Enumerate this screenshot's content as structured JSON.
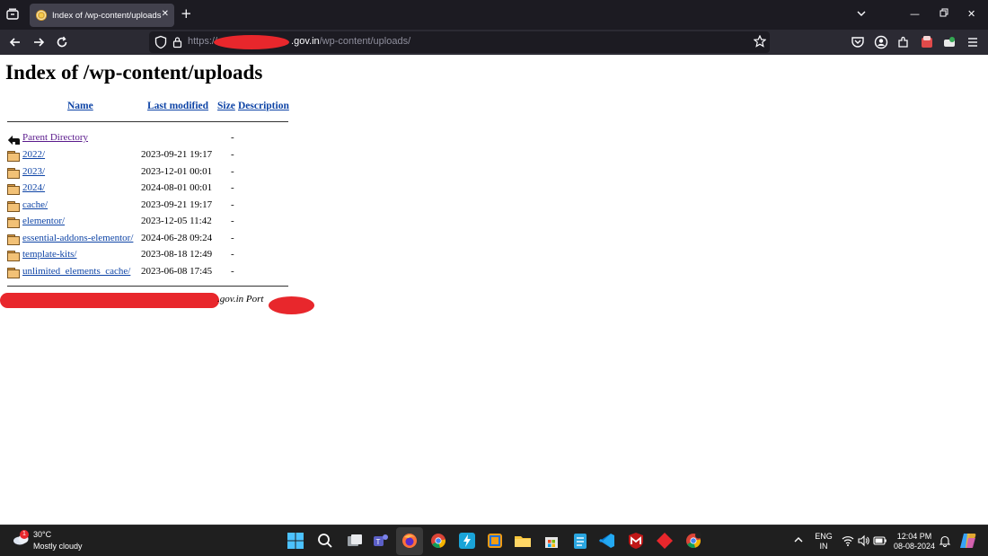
{
  "browser": {
    "tab_title": "Index of /wp-content/uploads",
    "url": {
      "scheme": "https://",
      "host_suffix": ".gov.in",
      "path": "/wp-content/uploads/"
    }
  },
  "page": {
    "heading": "Index of /wp-content/uploads",
    "columns": {
      "name": "Name",
      "last_modified": "Last modified",
      "size": "Size",
      "description": "Description"
    },
    "parent": {
      "name": "Parent Directory",
      "size": "-"
    },
    "rows": [
      {
        "name": "2022/",
        "modified": "2023-09-21 19:17",
        "size": "-"
      },
      {
        "name": "2023/",
        "modified": "2023-12-01 00:01",
        "size": "-"
      },
      {
        "name": "2024/",
        "modified": "2024-08-01 00:01",
        "size": "-"
      },
      {
        "name": "cache/",
        "modified": "2023-09-21 19:17",
        "size": "-"
      },
      {
        "name": "elementor/",
        "modified": "2023-12-05 11:42",
        "size": "-"
      },
      {
        "name": "essential-addons-elementor/",
        "modified": "2024-06-28 09:24",
        "size": "-"
      },
      {
        "name": "template-kits/",
        "modified": "2023-08-18 12:49",
        "size": "-"
      },
      {
        "name": "unlimited_elements_cache/",
        "modified": "2023-06-08 17:45",
        "size": "-"
      }
    ],
    "address": ".gov.in Port"
  },
  "taskbar": {
    "weather": {
      "badge": "1",
      "temp": "30°C",
      "condition": "Mostly cloudy"
    },
    "language": {
      "line1": "ENG",
      "line2": "IN"
    },
    "clock": {
      "time": "12:04 PM",
      "date": "08-08-2024"
    }
  },
  "colors": {
    "link": "#0e44a6",
    "visited_link": "#5a1a8c",
    "redaction": "#e8272c",
    "chrome_dark": "#1c1b22",
    "toolbar": "#2b2a33"
  }
}
